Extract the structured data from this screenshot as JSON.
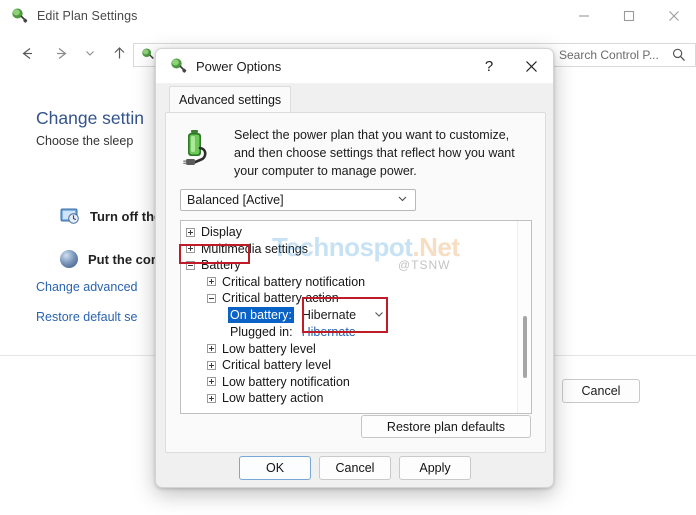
{
  "window": {
    "title": "Edit Plan Settings",
    "title_icon": "power-plug-icon",
    "controls": {
      "minimize": "–",
      "maximize": "□",
      "close": "×"
    },
    "nav": {
      "back": "back-arrow",
      "forward": "forward-arrow",
      "recent": "chevron-down",
      "up": "up-arrow"
    },
    "search": {
      "placeholder": "Search Control P...",
      "value": "Search Control P...",
      "icon": "search-icon"
    }
  },
  "background_page": {
    "heading": "Change settin",
    "subheading": "Choose the sleep",
    "rows": [
      {
        "icon": "monitor-icon",
        "label": "Turn off the "
      },
      {
        "icon": "sleep-icon",
        "label": "Put the comp"
      }
    ],
    "links": [
      "Change advanced",
      "Restore default se"
    ],
    "cancel_label": "Cancel"
  },
  "dialog": {
    "title": "Power Options",
    "title_icon": "power-plug-icon",
    "help_label": "?",
    "close_label": "✕",
    "tab": "Advanced settings",
    "description": "Select the power plan that you want to customize, and then choose settings that reflect how you want your computer to manage power.",
    "description_icon": "battery-plug-icon",
    "plan_select": {
      "value": "Balanced [Active]",
      "chevron": "chevron-down-icon"
    },
    "tree": [
      {
        "label": "Display",
        "state": "collapsed",
        "indent": 0
      },
      {
        "label": "Multimedia settings",
        "state": "collapsed",
        "indent": 0
      },
      {
        "label": "Battery",
        "state": "expanded",
        "indent": 0,
        "highlighted": true
      },
      {
        "label": "Critical battery notification",
        "state": "collapsed",
        "indent": 1
      },
      {
        "label": "Critical battery action",
        "state": "expanded",
        "indent": 1
      }
    ],
    "settings": {
      "on_battery": {
        "label": "On battery:",
        "value": "Hibernate",
        "selected": true,
        "chevron": "chevron-down-icon"
      },
      "plugged_in": {
        "label": "Plugged in:",
        "value": "Hibernate",
        "dropdown_open": true
      }
    },
    "tree_after": [
      {
        "label": "Low battery level",
        "state": "collapsed",
        "indent": 1
      },
      {
        "label": "Critical battery level",
        "state": "collapsed",
        "indent": 1
      },
      {
        "label": "Low battery notification",
        "state": "collapsed",
        "indent": 1
      },
      {
        "label": "Low battery action",
        "state": "collapsed",
        "indent": 1
      }
    ],
    "restore_defaults": "Restore plan defaults",
    "buttons": {
      "ok": "OK",
      "cancel": "Cancel",
      "apply": "Apply"
    }
  },
  "watermark": {
    "part1": "Technospot",
    "part2": ".Net",
    "handle": "@TSNW"
  },
  "colors": {
    "accent_blue": "#0a62c7",
    "link_blue": "#2a63b0",
    "annotation_red": "#c01c28",
    "heading_blue": "#34538b"
  }
}
